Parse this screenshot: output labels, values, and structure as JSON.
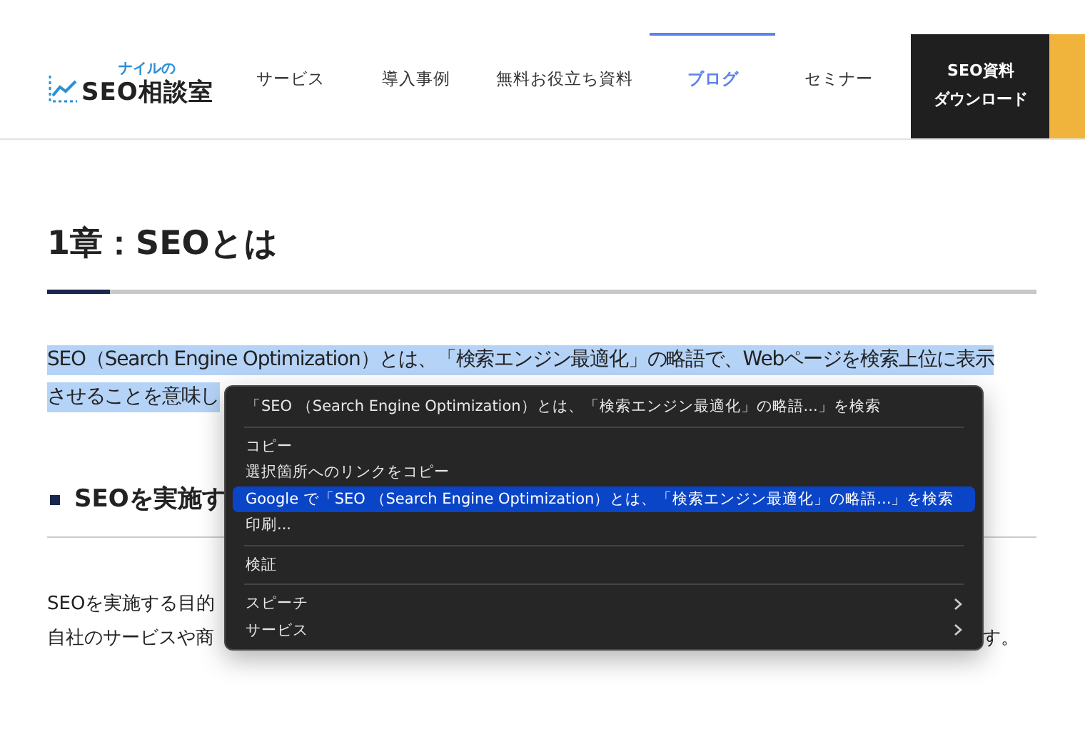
{
  "header": {
    "logo": {
      "small": "ナイルの",
      "main": "SEO相談室"
    },
    "nav": [
      {
        "label": "サービス",
        "selected": false
      },
      {
        "label": "導入事例",
        "selected": false
      },
      {
        "label": "無料お役立ち資料",
        "selected": false
      },
      {
        "label": "ブログ",
        "selected": true
      },
      {
        "label": "セミナー",
        "selected": false
      }
    ],
    "cta": [
      "SEO資料",
      "ダウンロード"
    ]
  },
  "article": {
    "title": "1章：SEOとは",
    "intro": [
      {
        "text": "SEO（Search Engine Optimization）とは、「検索エンジン最適化」の略語で、Webページを検索上位に表示",
        "selected": true
      },
      {
        "text": "させることを意味し",
        "selected": true
      }
    ],
    "heading": "SEOを実施す",
    "body": [
      {
        "left": "SEOを実施する目的"
      },
      {
        "left": "自社のサービスや商",
        "right": "す。"
      }
    ]
  },
  "context_menu": [
    {
      "kind": "item",
      "label": "「SEO （Search Engine Optimization）とは、「検索エンジン最適化」の略語...」を検索",
      "selected": false,
      "submenu": false
    },
    {
      "kind": "separator"
    },
    {
      "kind": "item",
      "label": "コピー",
      "selected": false,
      "submenu": false
    },
    {
      "kind": "item",
      "label": "選択箇所へのリンクをコピー",
      "selected": false,
      "submenu": false
    },
    {
      "kind": "item",
      "label": "Google で「SEO （Search Engine Optimization）とは、「検索エンジン最適化」の略語...」を検索",
      "selected": true,
      "submenu": false
    },
    {
      "kind": "item",
      "label": "印刷...",
      "selected": false,
      "submenu": false
    },
    {
      "kind": "separator"
    },
    {
      "kind": "item",
      "label": "検証",
      "selected": false,
      "submenu": false
    },
    {
      "kind": "separator"
    },
    {
      "kind": "item",
      "label": "スピーチ",
      "selected": false,
      "submenu": true
    },
    {
      "kind": "item",
      "label": "サービス",
      "selected": false,
      "submenu": true
    }
  ]
}
